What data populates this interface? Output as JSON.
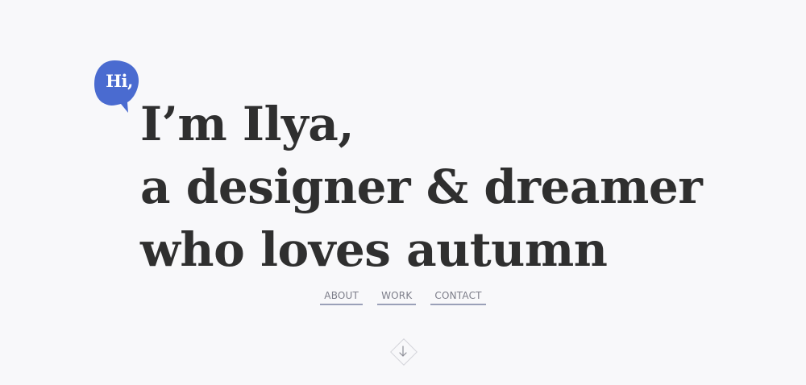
{
  "greeting": {
    "bubble_text": "Hi,",
    "bubble_color": "#4a6bd0"
  },
  "headline": {
    "lines": [
      "I’m Ilya,",
      "a designer & dreamer",
      "who loves autumn"
    ],
    "color": "#2f2f2f"
  },
  "nav": {
    "items": [
      {
        "label": "ABOUT"
      },
      {
        "label": "WORK"
      },
      {
        "label": "CONTACT"
      }
    ],
    "underline_color": "#9aa0b8"
  },
  "scroll": {
    "icon": "arrow-down-icon"
  },
  "background_color": "#f8f8fa"
}
